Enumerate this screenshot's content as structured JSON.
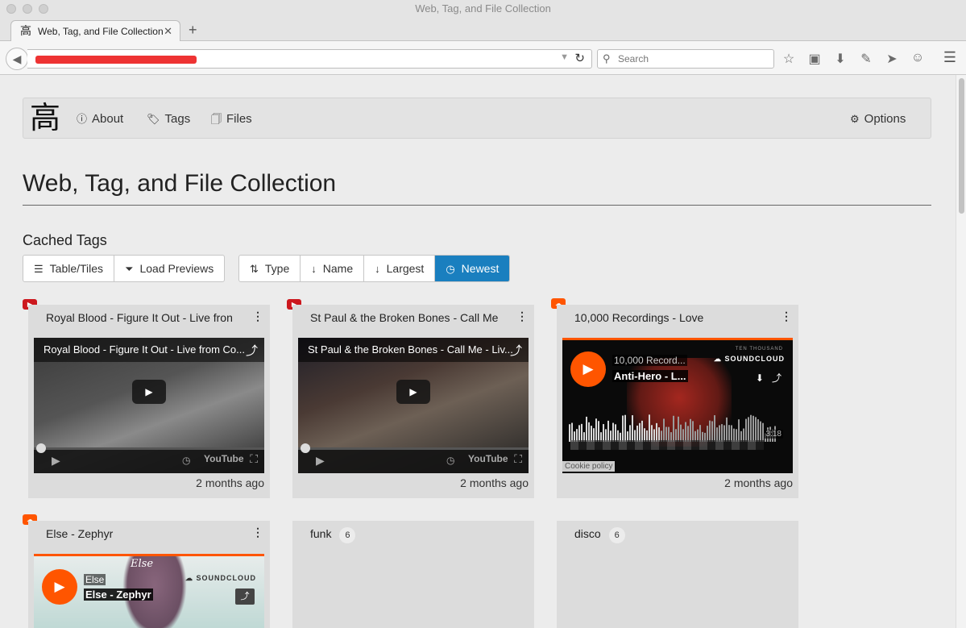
{
  "browser": {
    "window_title": "Web, Tag, and File Collection",
    "tab_title": "Web, Tag, and File Collection",
    "tab_favicon": "高",
    "search_placeholder": "Search"
  },
  "site": {
    "brand": "高",
    "nav": [
      {
        "label": "About",
        "icon": "info-icon"
      },
      {
        "label": "Tags",
        "icon": "tags-icon"
      },
      {
        "label": "Files",
        "icon": "files-icon"
      }
    ],
    "options_label": "Options",
    "page_title": "Web, Tag, and File Collection",
    "section_heading": "Cached Tags"
  },
  "view_buttons": [
    {
      "label": "Table/Tiles",
      "icon": "list-icon"
    },
    {
      "label": "Load Previews",
      "icon": "filter-icon"
    }
  ],
  "sort_buttons": [
    {
      "label": "Type",
      "icon": "sort-icon",
      "active": false
    },
    {
      "label": "Name",
      "icon": "sort-alpha-icon",
      "active": false
    },
    {
      "label": "Largest",
      "icon": "sort-amount-icon",
      "active": false
    },
    {
      "label": "Newest",
      "icon": "clock-icon",
      "active": true
    }
  ],
  "cards": [
    {
      "source": "youtube",
      "title": "Royal Blood - Figure It Out - Live fron",
      "player_title": "Royal Blood - Figure It Out - Live from Co...",
      "time": "2 months ago"
    },
    {
      "source": "youtube",
      "title": "St Paul & the Broken Bones - Call Me",
      "player_title": "St Paul & the Broken Bones - Call Me - Liv...",
      "time": "2 months ago"
    },
    {
      "source": "soundcloud",
      "title": "10,000 Recordings - Love",
      "player_user": "10,000 Record...",
      "player_track": "Anti-Hero - L...",
      "brand_top": "TEN THOUSAND",
      "brand": "SOUNDCLOUD",
      "duration": "3:18",
      "cookie": "Cookie policy",
      "time": "2 months ago"
    },
    {
      "source": "soundcloud",
      "title": "Else - Zephyr",
      "player_user": "Else",
      "player_track": "Else - Zephyr",
      "brand": "SOUNDCLOUD",
      "art_label": "Else"
    },
    {
      "source": "tag",
      "title": "funk",
      "count": "6"
    },
    {
      "source": "tag",
      "title": "disco",
      "count": "6"
    }
  ],
  "player": {
    "youtube_logo": "YouTube"
  },
  "colors": {
    "accent": "#1a7fbf",
    "youtube": "#cc181e",
    "soundcloud": "#ff5500"
  }
}
